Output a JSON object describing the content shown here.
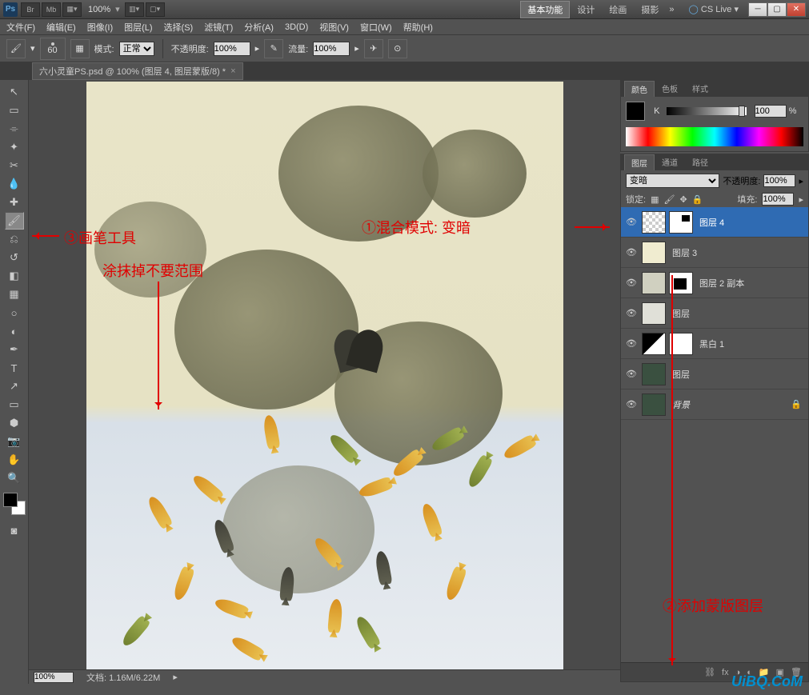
{
  "title": {
    "ps": "Ps",
    "br": "Br",
    "mb": "Mb",
    "zoom": "100%"
  },
  "workspace": {
    "basic": "基本功能",
    "design": "设计",
    "paint": "绘画",
    "photo": "摄影",
    "cslive": "CS Live"
  },
  "menu": {
    "file": "文件(F)",
    "edit": "编辑(E)",
    "image": "图像(I)",
    "layer": "图层(L)",
    "select": "选择(S)",
    "filter": "滤镜(T)",
    "analysis": "分析(A)",
    "_3d": "3D(D)",
    "view": "视图(V)",
    "window": "窗口(W)",
    "help": "帮助(H)"
  },
  "opt": {
    "brush_size": "60",
    "mode_label": "模式:",
    "mode_value": "正常",
    "opacity_label": "不透明度:",
    "opacity_value": "100%",
    "flow_label": "流量:",
    "flow_value": "100%"
  },
  "doctab": {
    "name": "六小灵童PS.psd @ 100% (图层 4, 图层蒙版/8) *"
  },
  "status": {
    "zoom": "100%",
    "doc": "文档: 1.16M/6.22M"
  },
  "color_panel": {
    "tab_color": "颜色",
    "tab_swatch": "色板",
    "tab_style": "样式",
    "k_label": "K",
    "k_value": "100",
    "pct": "%"
  },
  "layers_panel": {
    "tab_layers": "图层",
    "tab_channels": "通道",
    "tab_paths": "路径",
    "blend_mode": "变暗",
    "opacity_label": "不透明度:",
    "opacity_value": "100%",
    "lock_label": "锁定:",
    "fill_label": "填充:",
    "fill_value": "100%",
    "layers": [
      {
        "name": "图层 4",
        "selected": true,
        "mask": true,
        "thumb": "checker"
      },
      {
        "name": "图层 3",
        "thumb": "cream"
      },
      {
        "name": "图层 2 副本",
        "mask": true,
        "thumb": "img"
      },
      {
        "name": "图层",
        "thumb": "img"
      },
      {
        "name": "黑白 1",
        "mask": true,
        "thumb": "adj"
      },
      {
        "name": "图层",
        "thumb": "green"
      },
      {
        "name": "背景",
        "thumb": "green",
        "locked": true,
        "italic": true
      }
    ]
  },
  "annotations": {
    "a1": "①混合模式: 变暗",
    "a2": "②添加蒙版图层",
    "a3": "③画笔工具",
    "a3b": "涂抹掉不要范围"
  },
  "watermark": "UiBQ.CoM",
  "chart_data": null
}
